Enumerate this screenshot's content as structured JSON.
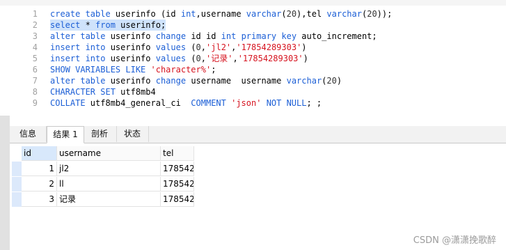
{
  "editor": {
    "lines": [
      {
        "n": "1",
        "segments": [
          {
            "t": "create table ",
            "c": "kw"
          },
          {
            "t": "userinfo (id ",
            "c": ""
          },
          {
            "t": "int",
            "c": "kw"
          },
          {
            "t": ",username ",
            "c": ""
          },
          {
            "t": "varchar",
            "c": "kw"
          },
          {
            "t": "(",
            "c": ""
          },
          {
            "t": "20",
            "c": "num"
          },
          {
            "t": "),tel ",
            "c": ""
          },
          {
            "t": "varchar",
            "c": "kw"
          },
          {
            "t": "(",
            "c": ""
          },
          {
            "t": "20",
            "c": "num"
          },
          {
            "t": "));",
            "c": ""
          }
        ]
      },
      {
        "n": "2",
        "selected": true,
        "segments": [
          {
            "t": "select",
            "c": "kw"
          },
          {
            "t": " * ",
            "c": ""
          },
          {
            "t": "from",
            "c": "kw"
          },
          {
            "t": " userinfo;",
            "c": ""
          }
        ]
      },
      {
        "n": "3",
        "segments": [
          {
            "t": "alter table ",
            "c": "kw"
          },
          {
            "t": "userinfo ",
            "c": ""
          },
          {
            "t": "change ",
            "c": "kw"
          },
          {
            "t": "id id ",
            "c": ""
          },
          {
            "t": "int primary key ",
            "c": "kw"
          },
          {
            "t": "auto_increment;",
            "c": ""
          }
        ]
      },
      {
        "n": "4",
        "segments": [
          {
            "t": "insert into ",
            "c": "kw"
          },
          {
            "t": "userinfo ",
            "c": ""
          },
          {
            "t": "values ",
            "c": "kw"
          },
          {
            "t": "(",
            "c": ""
          },
          {
            "t": "0",
            "c": "num"
          },
          {
            "t": ",",
            "c": ""
          },
          {
            "t": "'jl2'",
            "c": "str"
          },
          {
            "t": ",",
            "c": ""
          },
          {
            "t": "'17854289303'",
            "c": "str"
          },
          {
            "t": ")",
            "c": ""
          }
        ]
      },
      {
        "n": "5",
        "segments": [
          {
            "t": "insert into ",
            "c": "kw"
          },
          {
            "t": "userinfo ",
            "c": ""
          },
          {
            "t": "values ",
            "c": "kw"
          },
          {
            "t": "(",
            "c": ""
          },
          {
            "t": "0",
            "c": "num"
          },
          {
            "t": ",",
            "c": ""
          },
          {
            "t": "'记录'",
            "c": "str"
          },
          {
            "t": ",",
            "c": ""
          },
          {
            "t": "'17854289303'",
            "c": "str"
          },
          {
            "t": ")",
            "c": ""
          }
        ]
      },
      {
        "n": "6",
        "segments": [
          {
            "t": "SHOW VARIABLES LIKE ",
            "c": "kw"
          },
          {
            "t": "'character%'",
            "c": "str"
          },
          {
            "t": ";",
            "c": ""
          }
        ]
      },
      {
        "n": "7",
        "segments": [
          {
            "t": "alter table ",
            "c": "kw"
          },
          {
            "t": "userinfo ",
            "c": ""
          },
          {
            "t": "change ",
            "c": "kw"
          },
          {
            "t": "username  username ",
            "c": ""
          },
          {
            "t": "varchar",
            "c": "kw"
          },
          {
            "t": "(",
            "c": ""
          },
          {
            "t": "20",
            "c": "num"
          },
          {
            "t": ")",
            "c": ""
          }
        ]
      },
      {
        "n": "8",
        "segments": [
          {
            "t": "CHARACTER SET ",
            "c": "kw"
          },
          {
            "t": "utf8mb4",
            "c": ""
          }
        ]
      },
      {
        "n": "9",
        "segments": [
          {
            "t": "COLLATE ",
            "c": "kw"
          },
          {
            "t": "utf8mb4_general_ci  ",
            "c": ""
          },
          {
            "t": "COMMENT ",
            "c": "kw"
          },
          {
            "t": "'json'",
            "c": "str"
          },
          {
            "t": " ",
            "c": ""
          },
          {
            "t": "NOT NULL",
            "c": "kw"
          },
          {
            "t": "; ;",
            "c": ""
          }
        ]
      }
    ]
  },
  "tabs": [
    {
      "label": "信息",
      "active": false
    },
    {
      "label": "结果 1",
      "active": true
    },
    {
      "label": "剖析",
      "active": false
    },
    {
      "label": "状态",
      "active": false
    }
  ],
  "table": {
    "columns": [
      "id",
      "username",
      "tel"
    ],
    "rows": [
      [
        "1",
        "jl2",
        "178542"
      ],
      [
        "2",
        "ll",
        "178542"
      ],
      [
        "3",
        "记录",
        "178542"
      ]
    ]
  },
  "watermark": "CSDN @潇潇挽歌醉"
}
